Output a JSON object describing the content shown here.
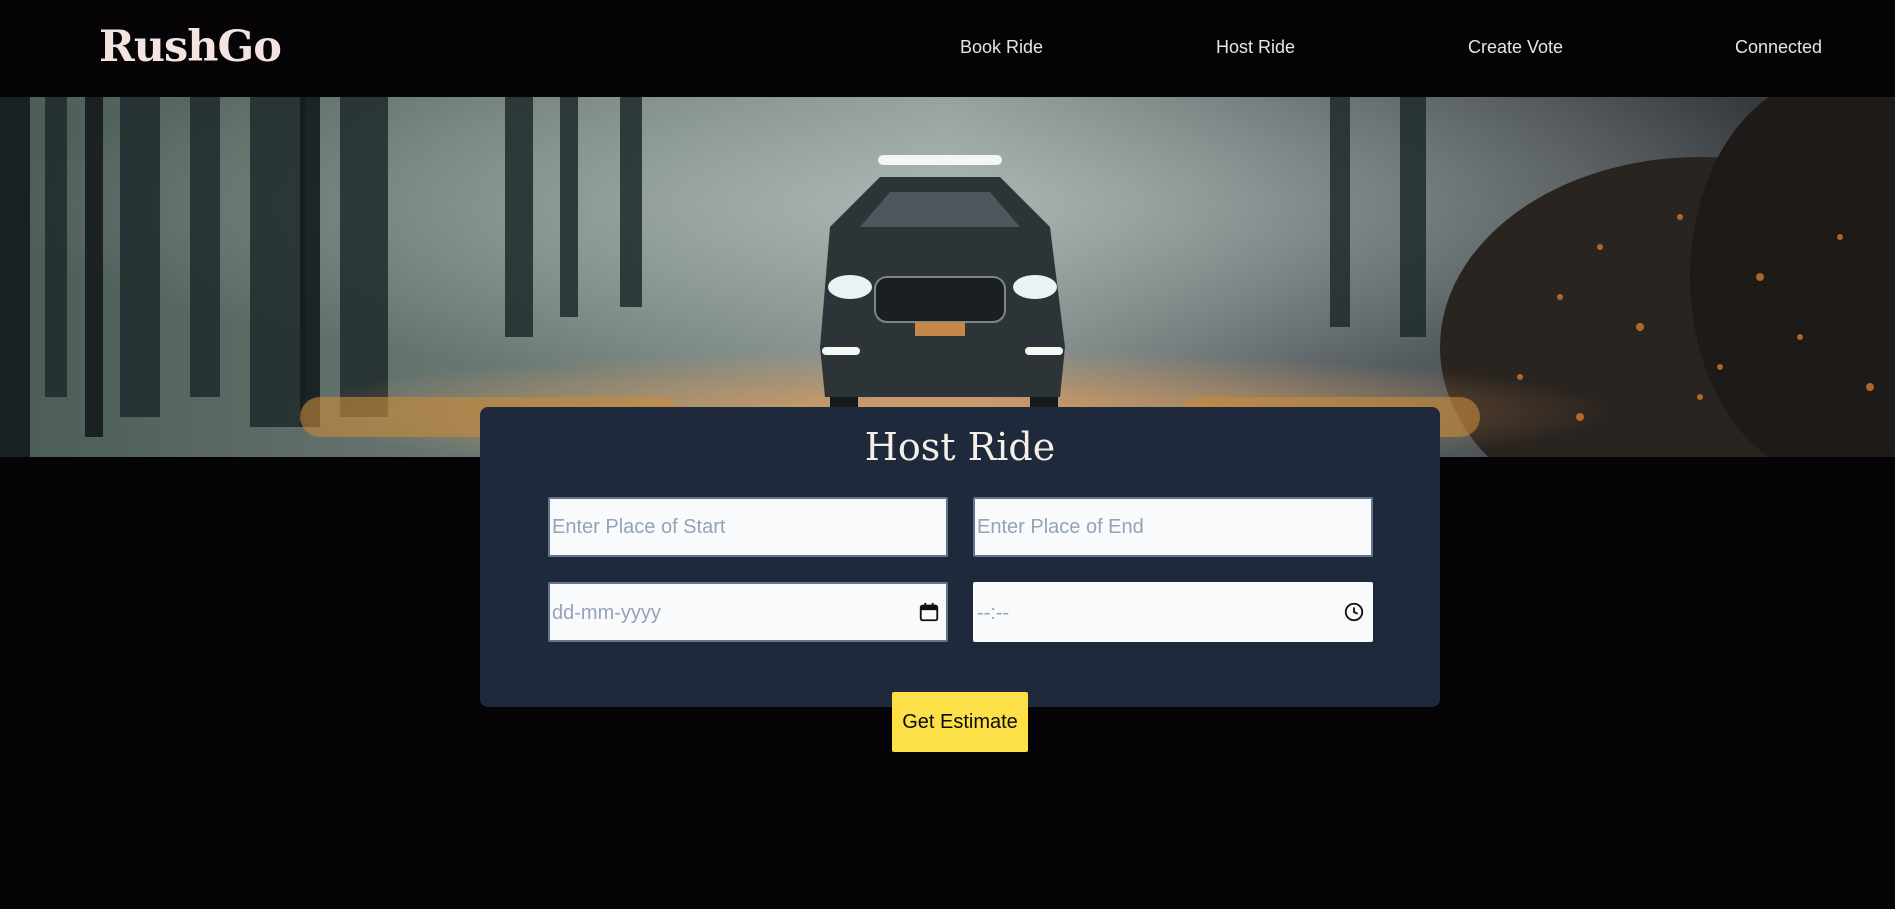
{
  "brand": {
    "logo": "RushGo"
  },
  "nav": {
    "book_ride": "Book Ride",
    "host_ride": "Host Ride",
    "create_vote": "Create Vote",
    "connected": "Connected"
  },
  "hero": {
    "image": "car-in-foggy-forest-at-night"
  },
  "form": {
    "title": "Host Ride",
    "start": {
      "placeholder": "Enter Place of Start",
      "value": ""
    },
    "end": {
      "placeholder": "Enter Place of End",
      "value": ""
    },
    "date": {
      "placeholder": "dd-mm-yyyy",
      "icon": "calendar-icon"
    },
    "time": {
      "placeholder": "--:--",
      "icon": "clock-icon"
    },
    "submit_label": "Get Estimate"
  },
  "colors": {
    "background": "#060407",
    "card": "#1e293b",
    "button": "#fde047",
    "logo": "#f4e4e0"
  }
}
